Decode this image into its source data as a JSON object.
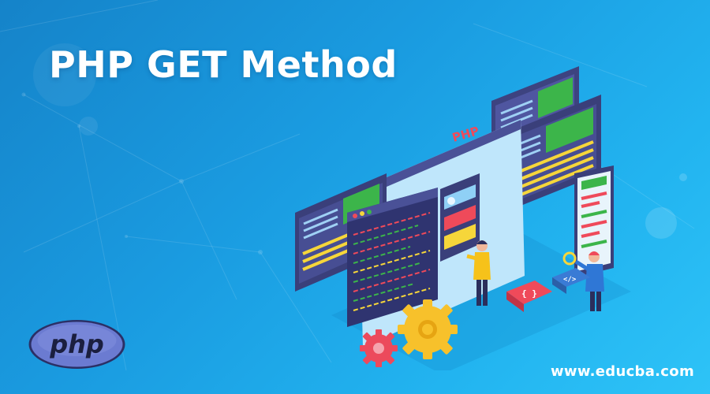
{
  "banner": {
    "title": "PHP GET Method",
    "screen_label": "PHP",
    "logo_text": "php",
    "website": "www.educba.com"
  },
  "colors": {
    "background_start": "#1583c9",
    "background_end": "#2ec3f7",
    "panel_navy": "#3a3f7a",
    "accent_green": "#3cb54a",
    "accent_yellow": "#f6d63a",
    "accent_red": "#ef4a5a",
    "gear_yellow": "#f7c12b",
    "gear_red": "#ec4a5c",
    "php_logo": "#6b7bd1"
  },
  "icons": [
    "gear-icon",
    "code-braces-icon",
    "code-tag-icon",
    "magnifier-icon"
  ]
}
